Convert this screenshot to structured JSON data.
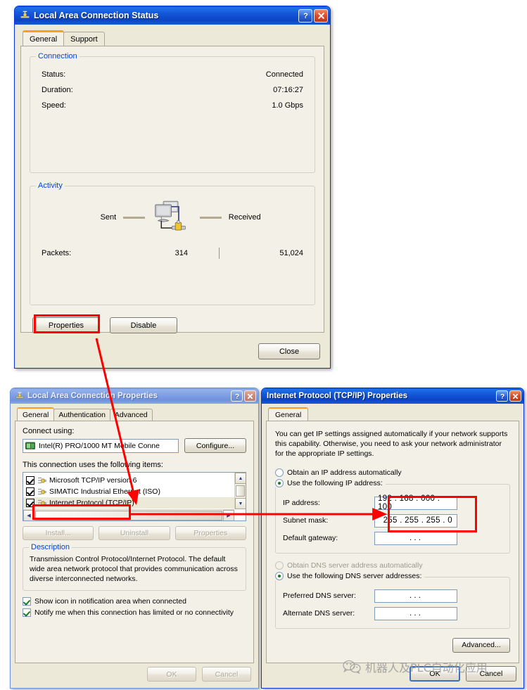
{
  "status_dialog": {
    "title": "Local Area Connection Status",
    "titlebar_buttons": {
      "help": "?",
      "close": "✕"
    },
    "tabs": [
      {
        "label": "General",
        "active": true
      },
      {
        "label": "Support",
        "active": false
      }
    ],
    "connection_group": {
      "title": "Connection",
      "rows": [
        {
          "label": "Status:",
          "value": "Connected"
        },
        {
          "label": "Duration:",
          "value": "07:16:27"
        },
        {
          "label": "Speed:",
          "value": "1.0 Gbps"
        }
      ]
    },
    "activity_group": {
      "title": "Activity",
      "sent_label": "Sent",
      "received_label": "Received",
      "packets_label": "Packets:",
      "packets_sent": "314",
      "packets_received": "51,024"
    },
    "buttons": {
      "properties": "Properties",
      "disable": "Disable",
      "close": "Close"
    }
  },
  "properties_dialog": {
    "title": "Local Area Connection Properties",
    "titlebar_buttons": {
      "help": "?",
      "close": "✕"
    },
    "tabs": [
      {
        "label": "General",
        "active": true
      },
      {
        "label": "Authentication",
        "active": false
      },
      {
        "label": "Advanced",
        "active": false
      }
    ],
    "connect_using_label": "Connect using:",
    "adapter_name": "Intel(R) PRO/1000 MT Mobile Conne",
    "configure_button": "Configure...",
    "items_label": "This connection uses the following items:",
    "items": [
      {
        "label": "Microsoft TCP/IP version 6",
        "checked": true,
        "selected": false
      },
      {
        "label": "SIMATIC Industrial Ethernet (ISO)",
        "checked": true,
        "selected": false
      },
      {
        "label": "Internet Protocol (TCP/IP)",
        "checked": true,
        "selected": true
      }
    ],
    "item_buttons": {
      "install": "Install...",
      "uninstall": "Uninstall",
      "properties": "Properties"
    },
    "description_group": {
      "title": "Description",
      "text": "Transmission Control Protocol/Internet Protocol. The default wide area network protocol that provides communication across diverse interconnected networks."
    },
    "checkboxes": [
      {
        "label": "Show icon in notification area when connected",
        "checked": true
      },
      {
        "label": "Notify me when this connection has limited or no connectivity",
        "checked": true
      }
    ],
    "buttons": {
      "ok": "OK",
      "cancel": "Cancel"
    }
  },
  "tcpip_dialog": {
    "title": "Internet Protocol (TCP/IP) Properties",
    "titlebar_buttons": {
      "help": "?",
      "close": "✕"
    },
    "tabs": [
      {
        "label": "General",
        "active": true
      }
    ],
    "intro_text": "You can get IP settings assigned automatically if your network supports this capability. Otherwise, you need to ask your network administrator for the appropriate IP settings.",
    "ip_auto_label": "Obtain an IP address automatically",
    "ip_manual_label": "Use the following IP address:",
    "ip_mode": "manual",
    "ip_rows": [
      {
        "label": "IP address:",
        "value": "192 . 168 . 000 . 100",
        "empty": false
      },
      {
        "label": "Subnet mask:",
        "value": "255 . 255 . 255 .   0",
        "empty": false
      },
      {
        "label": "Default gateway:",
        "value": ".     .     .",
        "empty": true
      }
    ],
    "dns_auto_label": "Obtain DNS server address automatically",
    "dns_manual_label": "Use the following DNS server addresses:",
    "dns_mode": "manual",
    "dns_rows": [
      {
        "label": "Preferred DNS server:",
        "value": ".     .     .",
        "empty": true
      },
      {
        "label": "Alternate DNS server:",
        "value": ".     .     .",
        "empty": true
      }
    ],
    "advanced_button": "Advanced...",
    "buttons": {
      "ok": "OK",
      "cancel": "Cancel"
    }
  },
  "annotations": {
    "accent_color": "#ff0000",
    "highlight_properties_button": true,
    "highlight_tcpip_item": true,
    "highlight_ip_fields": true
  },
  "watermark": {
    "text": "机器人及PLC自动化应用",
    "icon": "wechat-icon"
  }
}
